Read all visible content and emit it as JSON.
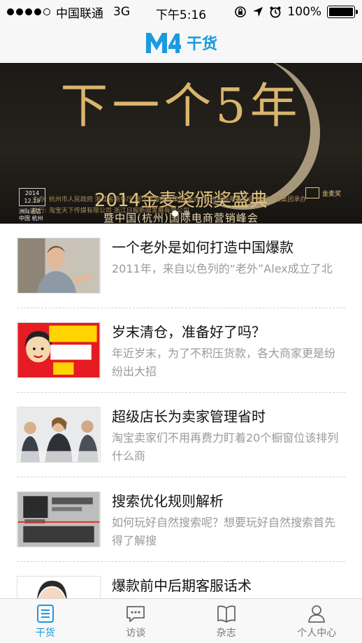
{
  "status_bar": {
    "carrier": "中国联通",
    "network": "3G",
    "time": "下午5:16",
    "battery": "100%",
    "battery_level": 1.0
  },
  "header": {
    "logo_icon": "m4-logo-icon",
    "title": "干货"
  },
  "banner": {
    "headline": "下一个5年",
    "subtitle": "2014金麦奖颁奖盛典",
    "subtitle2": "暨中国(杭州)国际电商营销峰会",
    "date_year": "2014",
    "date_day": "12.19",
    "venue": "洲际酒店",
    "venue_city": "中国 杭州",
    "award_logo": "金麦奖",
    "organizers_line1": "主办: 杭州市人民政府   浙江省商务厅   浙江日报报业集团                承办: 杭州市商务委员会   新报传媒集团承办",
    "organizers_line2": "执行: 淘宝天下传媒有限公司   浙江日报新闻发展有限公司",
    "page_count": 2,
    "active_page": 1
  },
  "articles": [
    {
      "title": "一个老外是如何打造中国爆款",
      "summary": "2011年，来自以色列的“老外”Alex成立了北",
      "thumb": "man-photo"
    },
    {
      "title": "岁末清仓，准备好了吗？",
      "summary": "年近岁末，为了不积压货款，各大商家更是纷纷出大招",
      "thumb": "sale-cartoon"
    },
    {
      "title": "超级店长为卖家管理省时",
      "summary": "淘宝卖家们不用再费力盯着20个橱窗位该排列什么商",
      "thumb": "meeting-photo"
    },
    {
      "title": "搜索优化规则解析",
      "summary": "如何玩好自然搜索呢？想要玩好自然搜索首先得了解搜",
      "thumb": "seo-search"
    },
    {
      "title": "爆款前中后期客服话术",
      "summary": "",
      "thumb": "woman-cartoon"
    }
  ],
  "tabs": [
    {
      "label": "干货",
      "icon": "list-doc-icon",
      "active": true
    },
    {
      "label": "访谈",
      "icon": "chat-bubble-icon",
      "active": false
    },
    {
      "label": "杂志",
      "icon": "open-book-icon",
      "active": false
    },
    {
      "label": "个人中心",
      "icon": "person-icon",
      "active": false
    }
  ],
  "colors": {
    "accent": "#1a9ae0",
    "banner_gold": "#d9b56e",
    "summary_gray": "#9a9a9a"
  }
}
